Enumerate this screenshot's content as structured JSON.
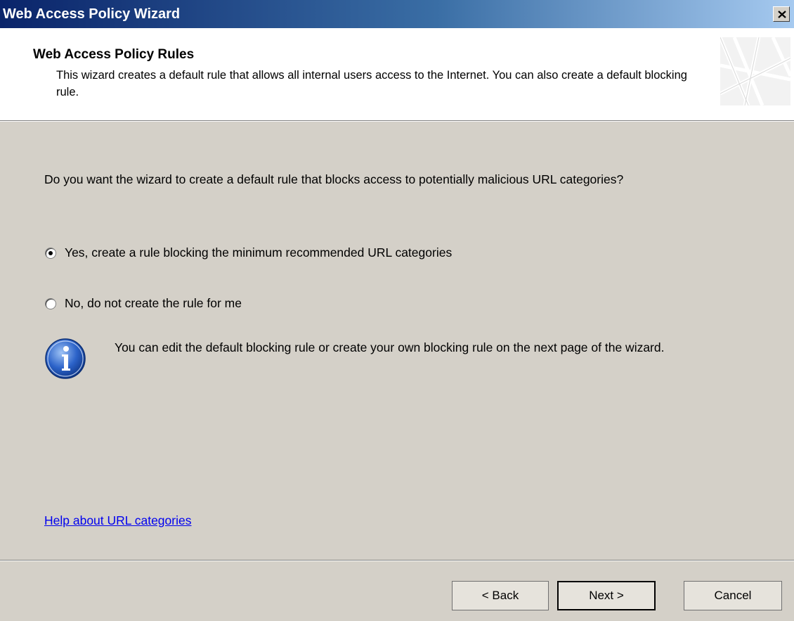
{
  "window": {
    "title": "Web Access Policy Wizard",
    "close_glyph": "✕"
  },
  "header": {
    "title": "Web Access Policy Rules",
    "description": "This wizard creates a default rule that allows all internal users access to the Internet. You can also create a default blocking rule."
  },
  "body": {
    "question": "Do you want the wizard to create a default rule that blocks access to potentially malicious URL categories?",
    "options": [
      {
        "label": "Yes, create a rule blocking the minimum recommended URL categories",
        "selected": true
      },
      {
        "label": "No, do not create the rule for me",
        "selected": false
      }
    ],
    "info_icon": "info-icon",
    "info_text": "You can edit the default blocking rule or create your own blocking rule on the next page of the wizard.",
    "help_link": "Help about URL categories"
  },
  "footer": {
    "back_label": "< Back",
    "next_label": "Next >",
    "cancel_label": "Cancel"
  },
  "colors": {
    "title_bar_start": "#0a246a",
    "dialog_bg": "#d4d0c8",
    "link": "#0000ee"
  }
}
